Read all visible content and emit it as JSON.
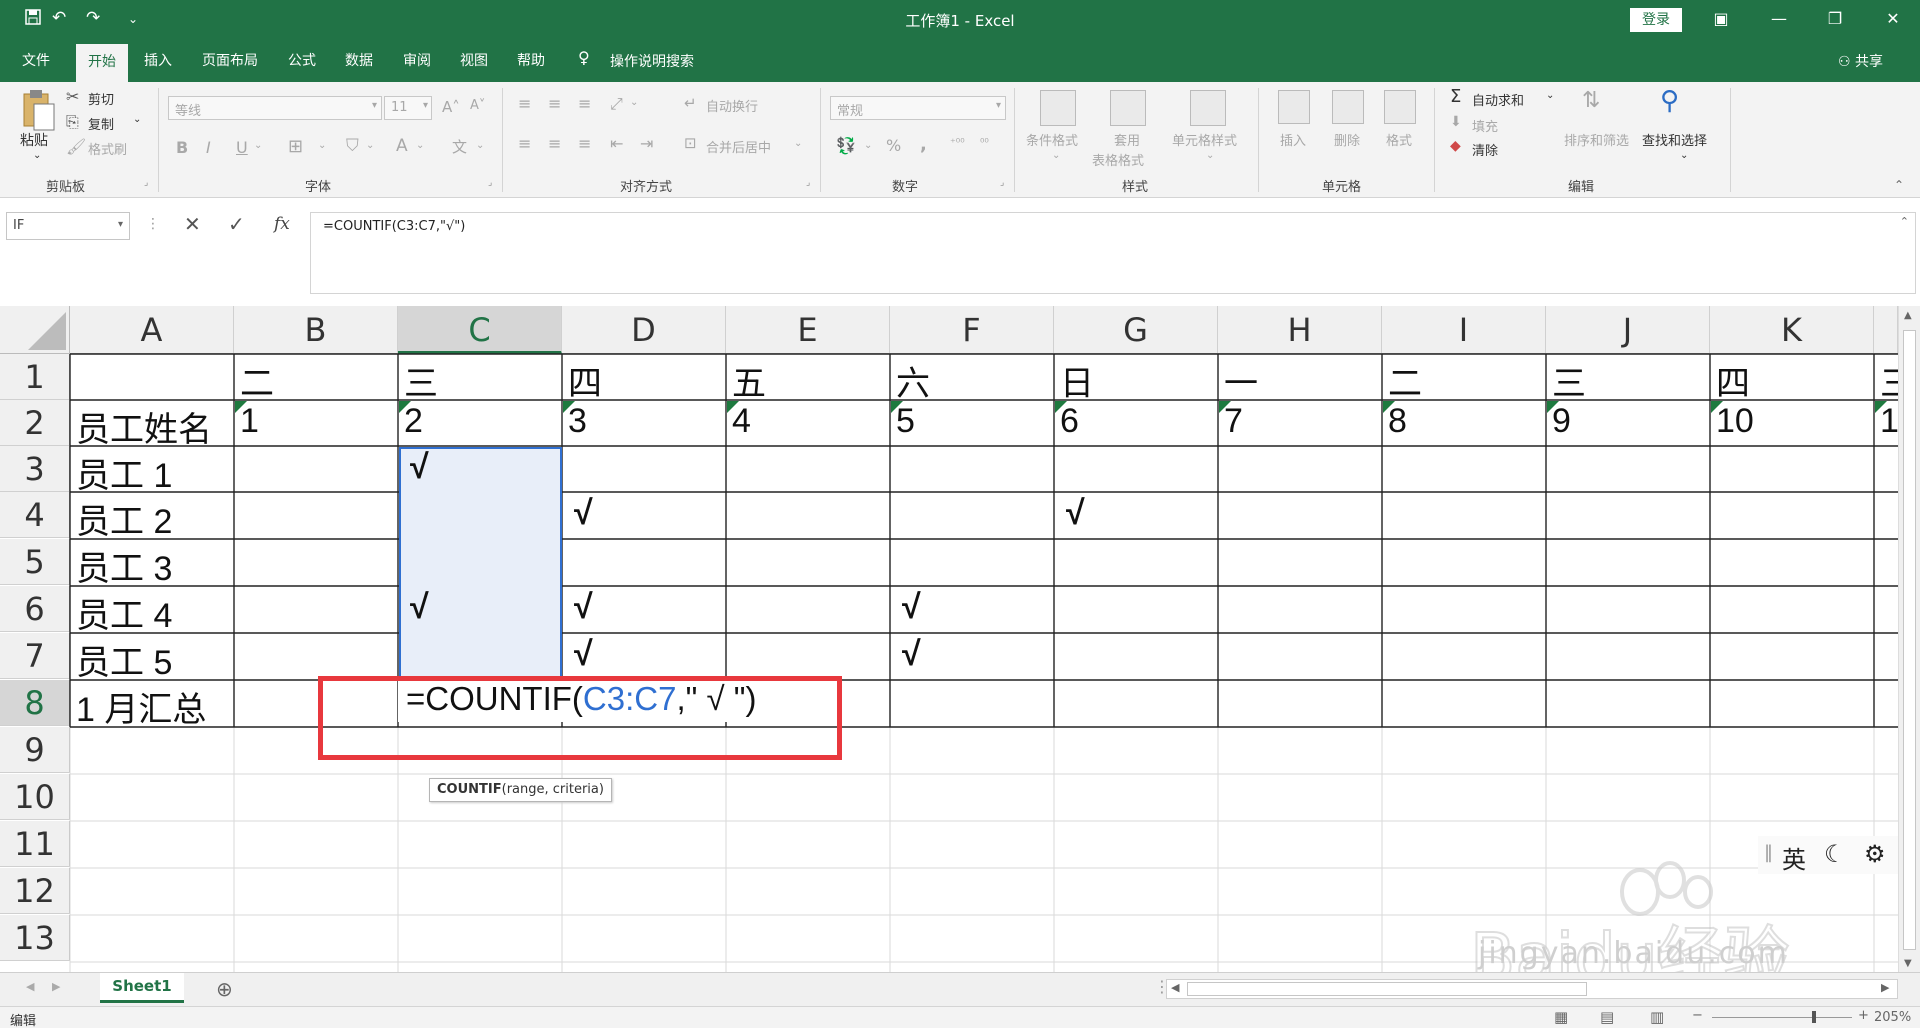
{
  "window": {
    "title": "工作簿1  -  Excel",
    "login_label": "登录",
    "qat_icons": [
      "save-icon",
      "undo-icon",
      "redo-icon",
      "customize-icon"
    ]
  },
  "tabs": [
    "文件",
    "开始",
    "插入",
    "页面布局",
    "公式",
    "数据",
    "审阅",
    "视图",
    "帮助"
  ],
  "active_tab": "开始",
  "tellme": "操作说明搜索",
  "share": "共享",
  "ribbon": {
    "clipboard": {
      "paste": "粘贴",
      "cut": "剪切",
      "copy": "复制",
      "format_painter": "格式刷",
      "label": "剪贴板"
    },
    "font": {
      "name": "等线",
      "size": "11",
      "bold": "B",
      "italic": "I",
      "underline": "U",
      "label": "字体",
      "color_a": "A",
      "wen": "文"
    },
    "alignment": {
      "wrap": "自动换行",
      "merge": "合并后居中",
      "label": "对齐方式"
    },
    "number": {
      "format": "常规",
      "percent": "%",
      "comma": ",",
      "label": "数字"
    },
    "styles": {
      "cond": "条件格式",
      "table1": "套用",
      "table2": "表格格式",
      "cell": "单元格样式",
      "label": "样式"
    },
    "cells": {
      "insert": "插入",
      "delete": "删除",
      "format": "格式",
      "label": "单元格"
    },
    "editing": {
      "autosum": "自动求和",
      "fill": "填充",
      "clear": "清除",
      "sort": "排序和筛选",
      "find": "查找和选择",
      "label": "编辑"
    }
  },
  "formula_bar": {
    "name_box": "IF",
    "formula": "=COUNTIF(C3:C7,\"√\")",
    "fx": "fx"
  },
  "columns": [
    "A",
    "B",
    "C",
    "D",
    "E",
    "F",
    "G",
    "H",
    "I",
    "J",
    "K"
  ],
  "rows": [
    "1",
    "2",
    "3",
    "4",
    "5",
    "6",
    "7",
    "8",
    "9",
    "10",
    "11",
    "12",
    "13"
  ],
  "cells": {
    "r1": [
      "",
      "二",
      "三",
      "四",
      "五",
      "六",
      "日",
      "一",
      "二",
      "三",
      "四"
    ],
    "r2": [
      "员工姓名",
      "1",
      "2",
      "3",
      "4",
      "5",
      "6",
      "7",
      "8",
      "9",
      "10"
    ],
    "r3": [
      "员工 1",
      "",
      "√",
      "",
      "",
      "",
      "",
      "",
      "",
      "",
      ""
    ],
    "r4": [
      "员工 2",
      "",
      "",
      "√",
      "",
      "",
      "√",
      "",
      "",
      "",
      ""
    ],
    "r5": [
      "员工 3",
      "",
      "",
      "",
      "",
      "",
      "",
      "",
      "",
      "",
      ""
    ],
    "r6": [
      "员工 4",
      "",
      "√",
      "√",
      "",
      "√",
      "",
      "",
      "",
      "",
      ""
    ],
    "r7": [
      "员工 5",
      "",
      "",
      "√",
      "",
      "√",
      "",
      "",
      "",
      "",
      ""
    ],
    "r8": [
      "1 月汇总",
      "",
      "",
      "",
      "",
      "",
      "",
      "",
      "",
      "",
      ""
    ]
  },
  "row1_partial": "三",
  "row2_partial": "1",
  "editing_cell": {
    "prefix": "=COUNTIF(",
    "range": "C3:C7",
    "suffix": ",\" √ \")"
  },
  "tooltip": {
    "func": "COUNTIF",
    "args": "(range, criteria)"
  },
  "ime": {
    "lang": "英"
  },
  "watermark": {
    "brand": "Baidu经验",
    "url": "jingyan.baidu.com"
  },
  "sheet_tab": "Sheet1",
  "status": {
    "mode": "编辑",
    "zoom": "205%"
  },
  "colors": {
    "excel_green": "#217346",
    "highlight_red": "#e8383d",
    "ref_blue": "#2f6fd1",
    "selection_fill": "#e8eef9"
  }
}
